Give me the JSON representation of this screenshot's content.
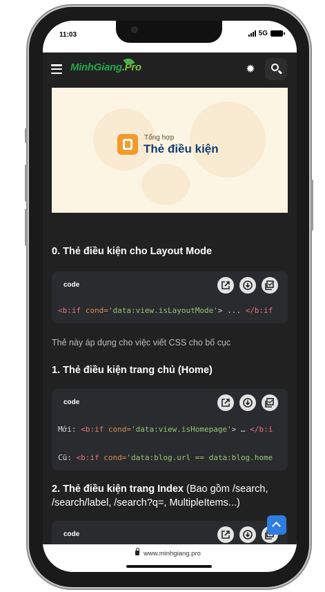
{
  "status": {
    "time": "11:03",
    "network": "5G"
  },
  "header": {
    "logo_main": "MinhGiang",
    "logo_suffix": ".Pro"
  },
  "hero": {
    "subtitle": "Tổng hợp",
    "title": "Thẻ điều kiện"
  },
  "content": {
    "h0": "0. Thẻ điều kiện cho Layout Mode",
    "code0": {
      "label": "code",
      "line1": {
        "t1": "<b:if ",
        "a1": "cond=",
        "s1": "'data:view.isLayoutMode'",
        "p1": "> ... ",
        "t2": "</b:if"
      }
    },
    "p0": "Thẻ này áp dụng cho việc viết CSS cho bố cục",
    "h1": "1. Thẻ điều kiện trang chủ (Home)",
    "code1": {
      "label": "code",
      "line1": {
        "p0": "Mới: ",
        "t1": "<b:if ",
        "a1": "cond=",
        "s1": "'data:view.isHomepage'",
        "p1": "> … ",
        "t2": "</b:i"
      },
      "line2": {
        "p0": "Cũ: ",
        "t1": "<b:if ",
        "a1": "cond=",
        "s1": "'data:blog.url == data:blog.home"
      }
    },
    "h2_bold": "2. Thẻ điều kiện trang Index",
    "h2_normal": " (Bao gồm /search, /search/label, /search?q=, MultipleItems...)",
    "code2": {
      "label": "code"
    }
  },
  "browser": {
    "url": "www.minhgiang.pro"
  },
  "icons": [
    "menu-icon",
    "settings-icon",
    "search-icon",
    "open-new-icon",
    "download-icon",
    "copy-icon",
    "chevron-up-icon",
    "lock-icon"
  ]
}
